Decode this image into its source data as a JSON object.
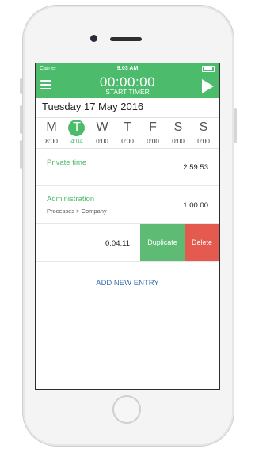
{
  "status_bar": {
    "carrier": "Carrier",
    "time": "9:03 AM"
  },
  "header": {
    "timer": "00:00:00",
    "start_label": "START TIMER"
  },
  "date_title": "Tuesday 17 May 2016",
  "days": [
    {
      "letter": "M",
      "hours": "8:00",
      "active": false
    },
    {
      "letter": "T",
      "hours": "4:04",
      "active": true
    },
    {
      "letter": "W",
      "hours": "0:00",
      "active": false
    },
    {
      "letter": "T",
      "hours": "0:00",
      "active": false
    },
    {
      "letter": "F",
      "hours": "0:00",
      "active": false
    },
    {
      "letter": "S",
      "hours": "0:00",
      "active": false
    },
    {
      "letter": "S",
      "hours": "0:00",
      "active": false
    }
  ],
  "entries": [
    {
      "title": "Private time",
      "subtitle": "",
      "duration": "2:59:53"
    },
    {
      "title": "Administration",
      "subtitle": "Processes > Company",
      "duration": "1:00:00"
    }
  ],
  "swiped_entry": {
    "duration": "0:04:11",
    "duplicate_label": "Duplicate",
    "delete_label": "Delete"
  },
  "add_entry_label": "ADD NEW ENTRY",
  "colors": {
    "accent": "#4cbb6c",
    "delete": "#e45a4f",
    "link": "#3a6fb0"
  },
  "icons": {
    "menu": "hamburger-menu-icon",
    "play": "play-icon"
  }
}
